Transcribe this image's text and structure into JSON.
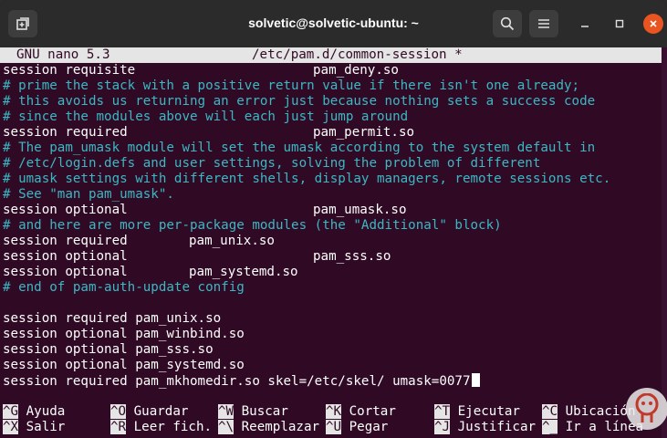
{
  "window": {
    "title": "solvetic@solvetic-ubuntu: ~",
    "buttons": {
      "new_tab": "new-tab-icon",
      "search": "search-icon",
      "menu": "hamburger-menu-icon",
      "minimize": "minimize-icon",
      "maximize": "maximize-icon",
      "close": "close-icon"
    }
  },
  "colors": {
    "terminal_bg": "#300a24",
    "comment": "#3bb8c4",
    "text": "#ffffff",
    "titlebar": "#2b2b2b",
    "close": "#e95420"
  },
  "nano": {
    "version": "GNU nano 5.3",
    "filename": "/etc/pam.d/common-session *"
  },
  "lines": [
    {
      "text": "session requisite",
      "module": "pam_deny.so",
      "col": "wide"
    },
    {
      "text": "# prime the stack with a positive return value if there isn't one already;",
      "comment": true
    },
    {
      "text": "# this avoids us returning an error just because nothing sets a success code",
      "comment": true
    },
    {
      "text": "# since the modules above will each just jump around",
      "comment": true
    },
    {
      "text": "session required",
      "module": "pam_permit.so",
      "col": "wide"
    },
    {
      "text": "# The pam_umask module will set the umask according to the system default in",
      "comment": true
    },
    {
      "text": "# /etc/login.defs and user settings, solving the problem of different",
      "comment": true
    },
    {
      "text": "# umask settings with different shells, display managers, remote sessions etc.",
      "comment": true
    },
    {
      "text": "# See \"man pam_umask\".",
      "comment": true
    },
    {
      "text": "session optional",
      "module": "pam_umask.so",
      "col": "wide"
    },
    {
      "text": "# and here are more per-package modules (the \"Additional\" block)",
      "comment": true
    },
    {
      "text": "session required",
      "module": "pam_unix.so",
      "col": "mid"
    },
    {
      "text": "session optional",
      "module": "pam_sss.so",
      "col": "wide"
    },
    {
      "text": "session optional",
      "module": "pam_systemd.so",
      "col": "mid"
    },
    {
      "text": "# end of pam-auth-update config",
      "comment": true
    },
    {
      "text": ""
    },
    {
      "text": "session required pam_unix.so"
    },
    {
      "text": "session optional pam_winbind.so"
    },
    {
      "text": "session optional pam_sss.so"
    },
    {
      "text": "session optional pam_systemd.so"
    },
    {
      "text": "session required pam_mkhomedir.so skel=/etc/skel/ umask=0077",
      "cursor": true
    }
  ],
  "help_rows": [
    [
      {
        "key": "^G",
        "label": "Ayuda"
      },
      {
        "key": "^O",
        "label": "Guardar"
      },
      {
        "key": "^W",
        "label": "Buscar"
      },
      {
        "key": "^K",
        "label": "Cortar"
      },
      {
        "key": "^T",
        "label": "Ejecutar"
      },
      {
        "key": "^C",
        "label": "Ubicación"
      }
    ],
    [
      {
        "key": "^X",
        "label": "Salir"
      },
      {
        "key": "^R",
        "label": "Leer fich."
      },
      {
        "key": "^\\",
        "label": "Reemplazar"
      },
      {
        "key": "^U",
        "label": "Pegar"
      },
      {
        "key": "^J",
        "label": "Justificar"
      },
      {
        "key": "^_",
        "label": "Ir a línea"
      }
    ]
  ],
  "watermark": "solvetic-logo"
}
